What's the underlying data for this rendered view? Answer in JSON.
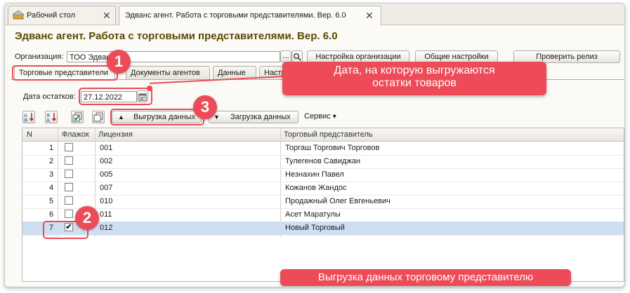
{
  "window_tabs": [
    {
      "label": "Рабочий стол",
      "active": false
    },
    {
      "label": "Эдванс агент. Работа с торговыми представителями. Вер. 6.0",
      "active": true
    }
  ],
  "close_glyph": "✕",
  "form_title": "Эдванс агент. Работа с торговыми представителями. Вер. 6.0",
  "org": {
    "label": "Организация:",
    "value": "ТОО Эдванс",
    "select_glyph": "...",
    "search_icon": "search-icon"
  },
  "header_buttons": {
    "org_settings": "Настройка организации",
    "general_settings": "Общие настройки",
    "check_release": "Проверить релиз"
  },
  "page_tabs": [
    "Торговые представители",
    "Документы агентов",
    "Данные",
    "Настр"
  ],
  "date": {
    "label": "Дата остатков:",
    "value": "27.12.2022",
    "calendar_icon": "calendar-icon"
  },
  "toolbar": {
    "sort_asc_icon": "sort-ascending-icon",
    "sort_desc_icon": "sort-descending-icon",
    "check_all_icon": "check-all-icon",
    "uncheck_all_icon": "uncheck-all-icon",
    "upload_label": "Выгрузка данных",
    "download_label": "Загрузка данных",
    "service_label": "Сервис",
    "service_arrow": "▾"
  },
  "table": {
    "columns": [
      "N",
      "Флажок",
      "Лицензия",
      "Торговый представитель"
    ],
    "rows": [
      {
        "n": "1",
        "checked": false,
        "license": "001",
        "agent": "Торгаш Торгович Торговов"
      },
      {
        "n": "2",
        "checked": false,
        "license": "002",
        "agent": "Тулегенов Савиджан"
      },
      {
        "n": "3",
        "checked": false,
        "license": "005",
        "agent": "Незнахин Павел"
      },
      {
        "n": "4",
        "checked": false,
        "license": "007",
        "agent": "Кожанов Жандос"
      },
      {
        "n": "5",
        "checked": false,
        "license": "010",
        "agent": "Продажный Олег Евгеньевич"
      },
      {
        "n": "6",
        "checked": false,
        "license": "011",
        "agent": "Асет Маратулы"
      },
      {
        "n": "7",
        "checked": true,
        "license": "012",
        "agent": "Новый Торговый"
      }
    ],
    "check_glyph": "✔"
  },
  "annotations": {
    "badge1": "1",
    "badge2": "2",
    "badge3": "3",
    "callout_top_line1": "Дата, на которую выгружаются",
    "callout_top_line2": "остатки товаров",
    "callout_bottom": "Выгрузка данных торговому представителю"
  },
  "colors": {
    "accent": "#ec4b57",
    "title": "#5a4a00",
    "selected_row": "#cfdff2"
  }
}
